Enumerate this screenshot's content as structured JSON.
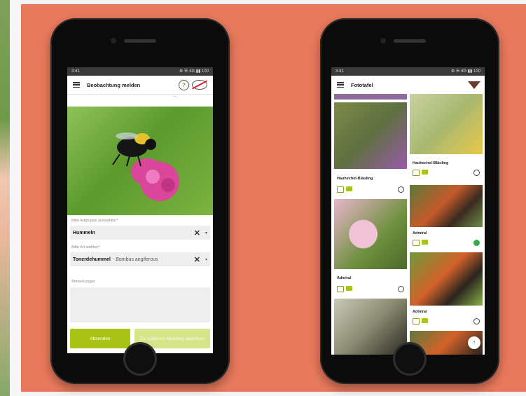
{
  "phone1": {
    "status_time": "3:41",
    "status_icons": "⚙ ☰ 4G ▮▮ 100",
    "title": "Beobachtung melden",
    "help_icon": "?",
    "top_hint": "—",
    "label_group": "Bitte Artgruppe auswählen*",
    "group_value": "Hummeln",
    "label_species": "Bitte Art wählen*",
    "species_value": "Tonerdehummel",
    "species_latin": "- Bombus angiferous",
    "label_notes": "Anmerkungen",
    "clear_icon": "✕",
    "caret_icon": "▾",
    "send_button": "Absenden",
    "save_button": "Zur späteren Meldung speichern"
  },
  "phone2": {
    "status_time": "3:41",
    "status_icons": "⚙ ☰ 4G ▮▮ 100",
    "title": "Fototafel",
    "tiles": [
      {
        "caption": "Hauhechel-Bläuling"
      },
      {
        "caption": "Hauhechel-Bläuling"
      },
      {
        "caption": "Admiral"
      },
      {
        "caption": "Admiral"
      },
      {
        "caption": "Admiral"
      }
    ],
    "fab_icon": "↑"
  },
  "colors": {
    "background": "#e8795c",
    "accent": "#a9c417",
    "accent_light": "#d7e58a"
  }
}
